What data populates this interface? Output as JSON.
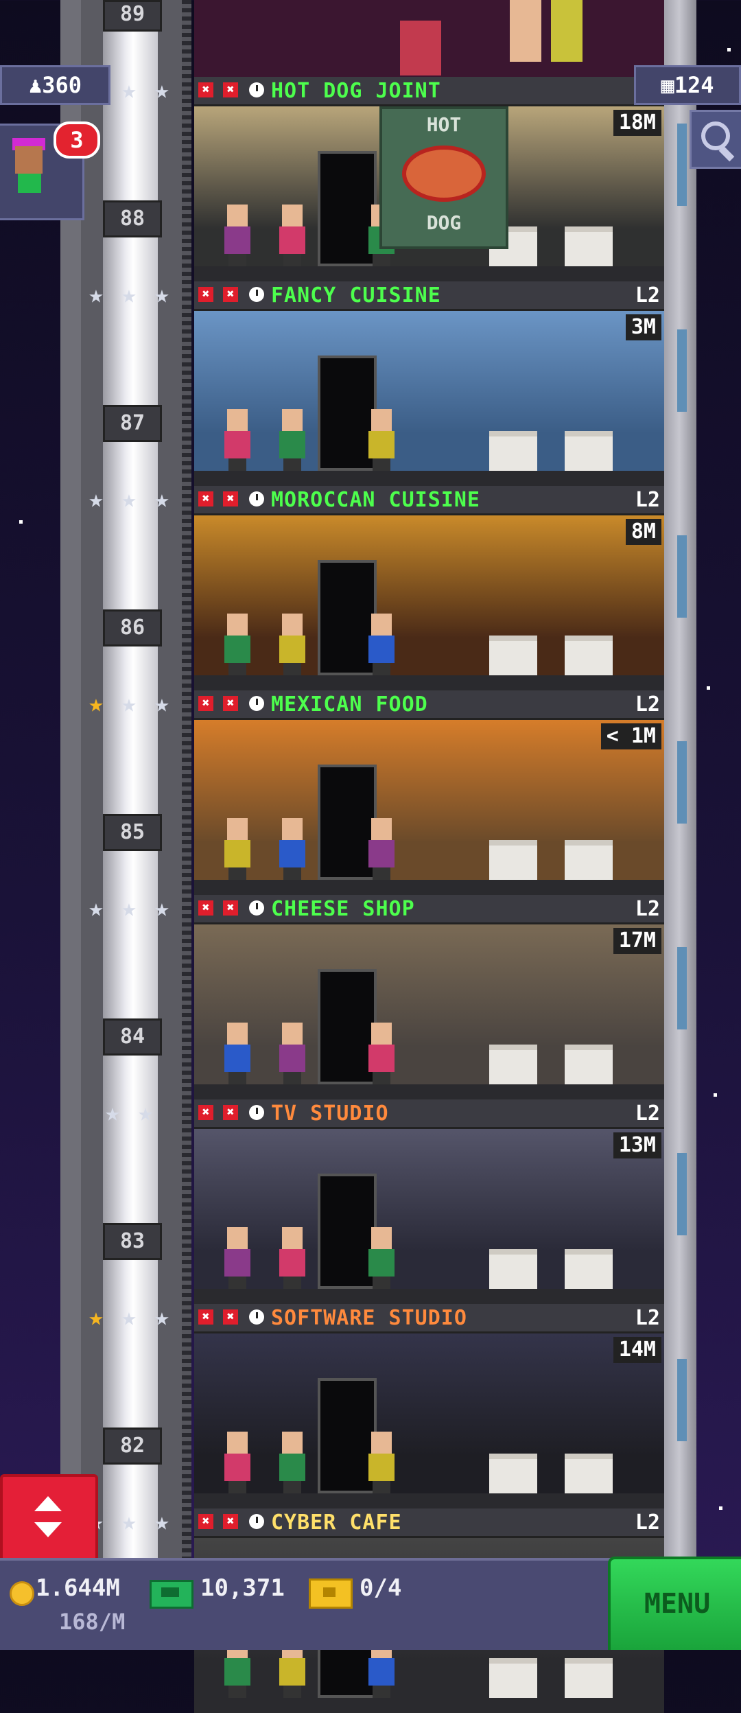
{
  "hud": {
    "population": "360",
    "floor_count": "124",
    "visitor_badge": "3"
  },
  "top_floor_number": "89",
  "floors": [
    {
      "name": "HOT DOG JOINT",
      "level": "",
      "timer": "18M",
      "number": "88",
      "name_color": "#4dff4d",
      "stars_gold": 0,
      "stars_total": 3
    },
    {
      "name": "FANCY CUISINE",
      "level": "L2",
      "timer": "3M",
      "number": "87",
      "name_color": "#4dff4d",
      "stars_gold": 0,
      "stars_total": 3
    },
    {
      "name": "MOROCCAN CUISINE",
      "level": "L2",
      "timer": "8M",
      "number": "86",
      "name_color": "#4dff4d",
      "stars_gold": 0,
      "stars_total": 3
    },
    {
      "name": "MEXICAN FOOD",
      "level": "L2",
      "timer": "< 1M",
      "number": "85",
      "name_color": "#4dff4d",
      "stars_gold": 1,
      "stars_total": 3
    },
    {
      "name": "CHEESE SHOP",
      "level": "L2",
      "timer": "17M",
      "number": "84",
      "name_color": "#4dff4d",
      "stars_gold": 0,
      "stars_total": 3
    },
    {
      "name": "TV STUDIO",
      "level": "L2",
      "timer": "13M",
      "number": "83",
      "name_color": "#ff8a3d",
      "stars_gold": 0,
      "stars_total": 2
    },
    {
      "name": "SOFTWARE STUDIO",
      "level": "L2",
      "timer": "14M",
      "number": "82",
      "name_color": "#ff8a3d",
      "stars_gold": 1,
      "stars_total": 3
    },
    {
      "name": "CYBER CAFE",
      "level": "L2",
      "timer": "",
      "number": "",
      "name_color": "#ffe06a",
      "stars_gold": 0,
      "stars_total": 3
    }
  ],
  "scene_text": {
    "hotdog_sign_top": "HOT",
    "hotdog_sign_bottom": "DOG"
  },
  "bottom_bar": {
    "coins": "1.644M",
    "coin_rate": "168/M",
    "bux": "10,371",
    "tickets": "0/4",
    "menu_label": "MENU"
  }
}
